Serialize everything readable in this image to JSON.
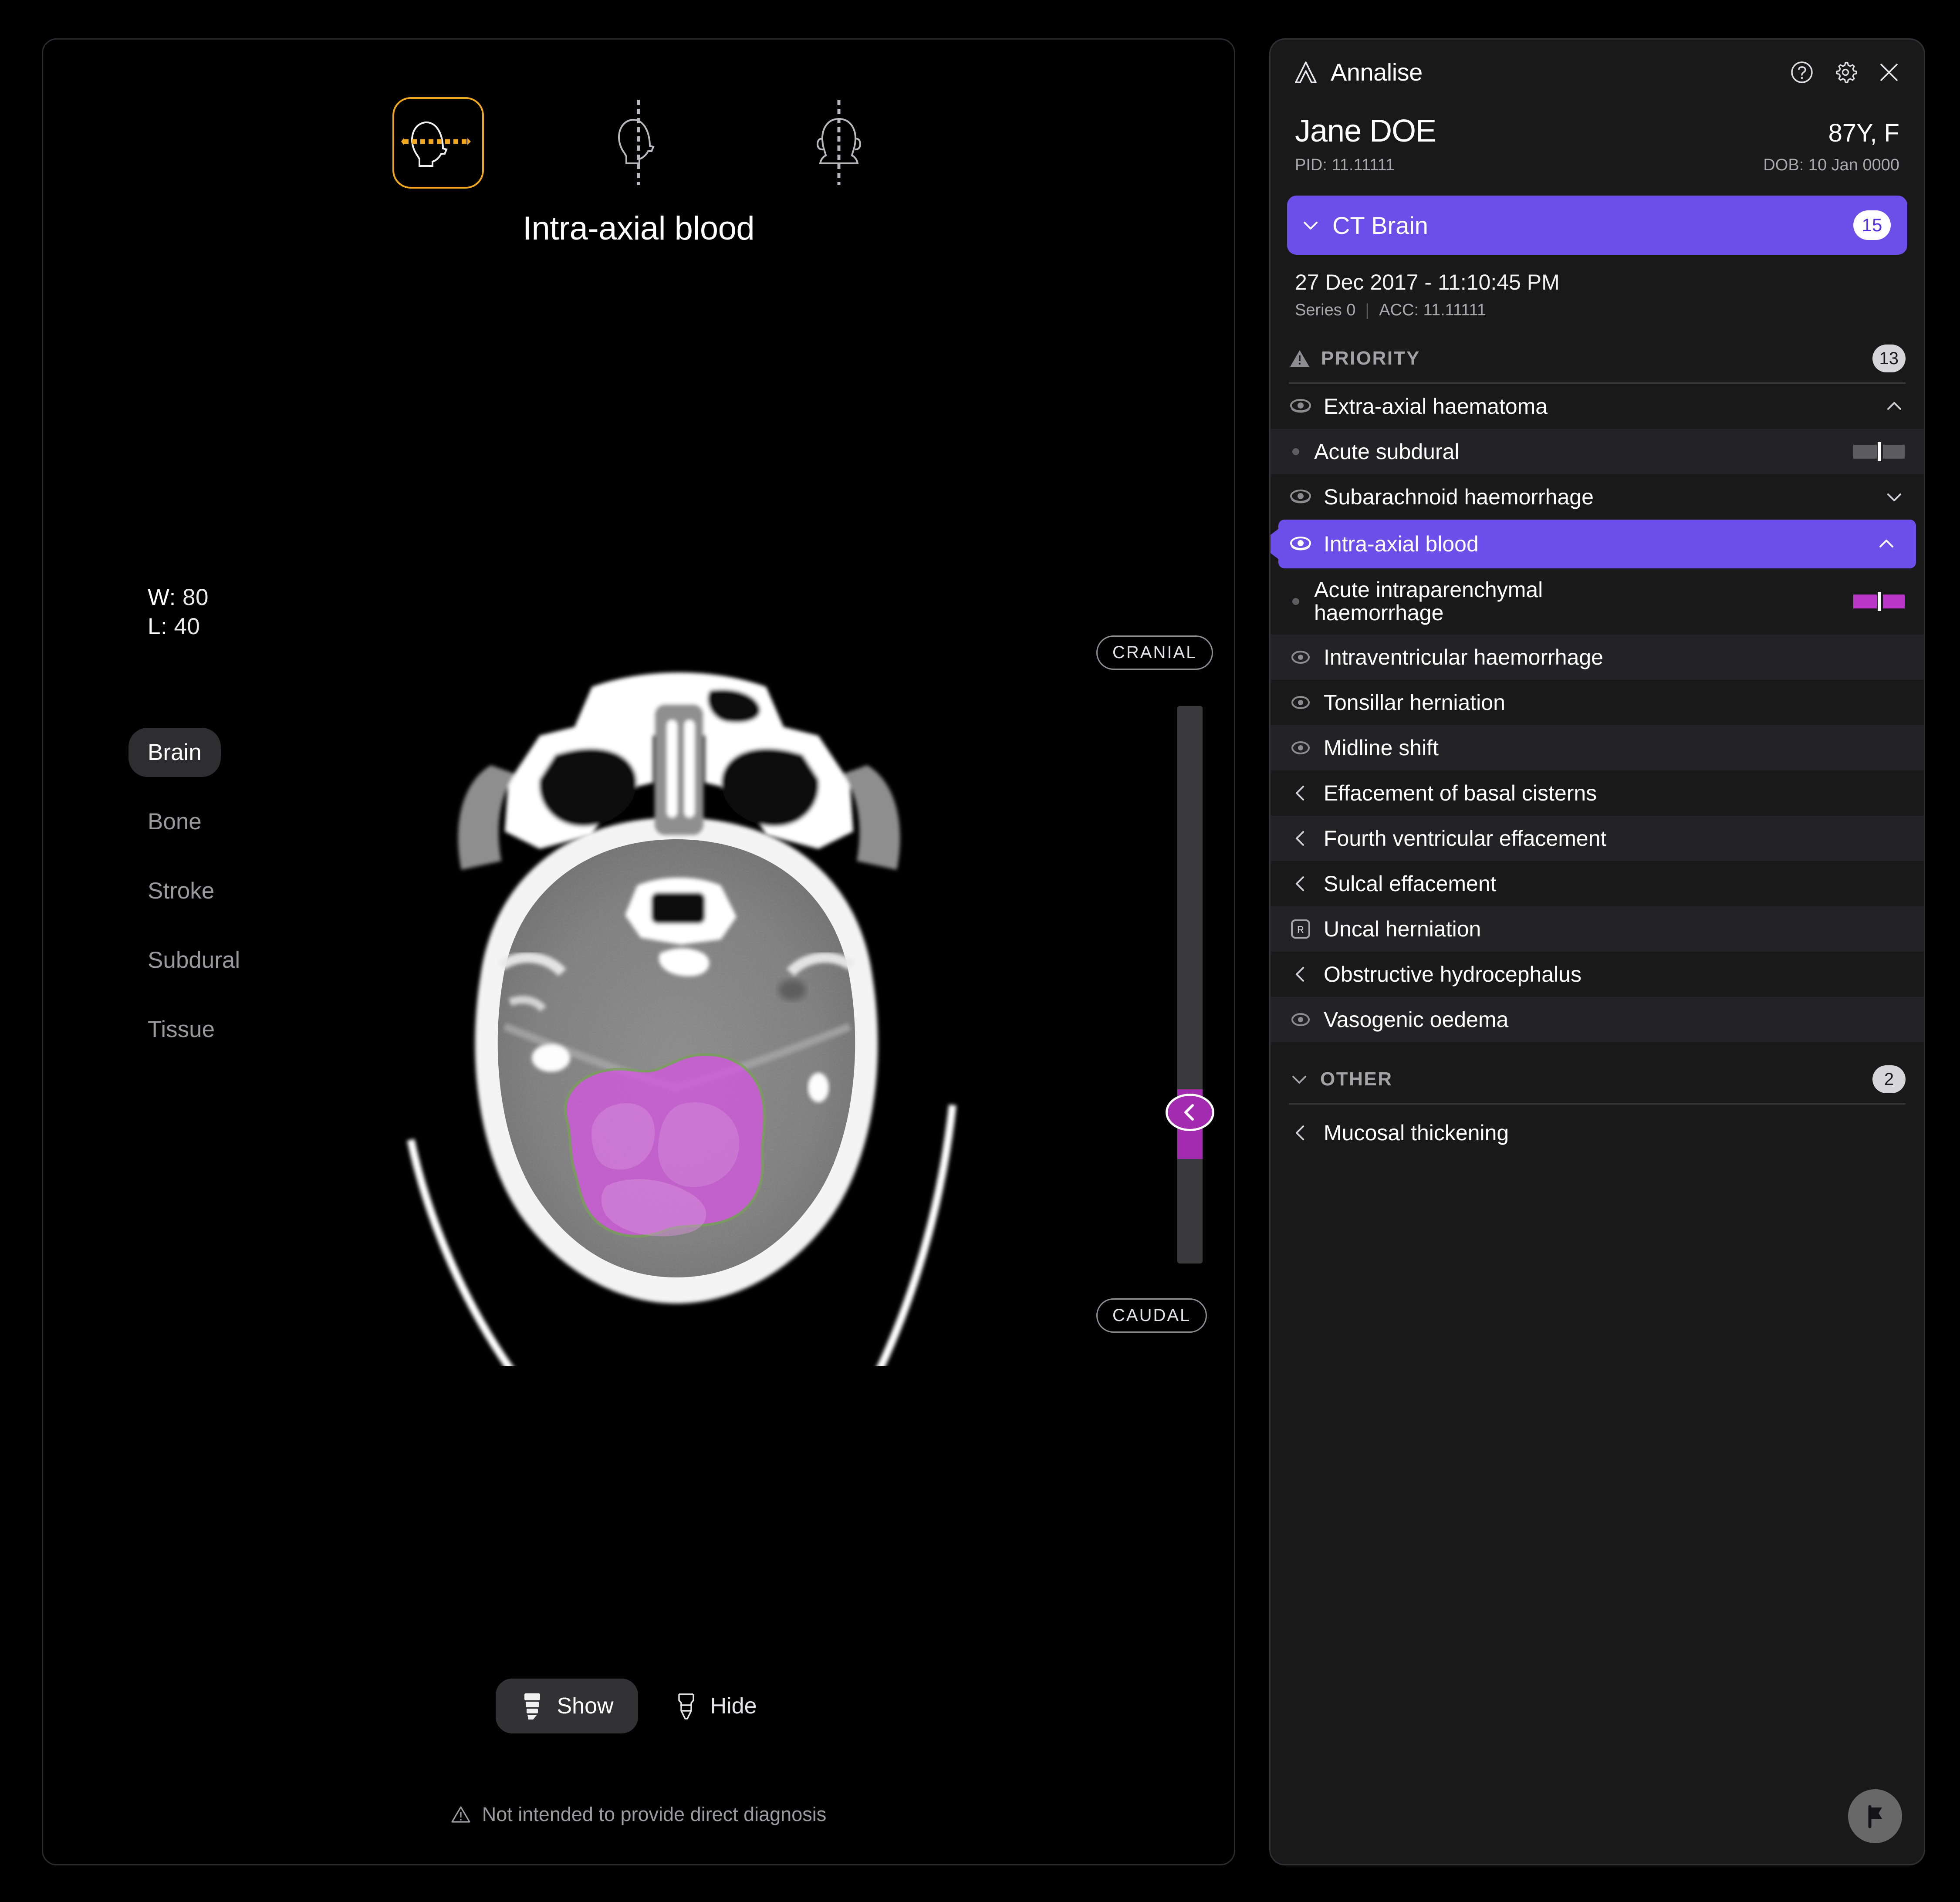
{
  "viewer": {
    "orientations": [
      {
        "name": "axial",
        "label": "Axial",
        "active": true
      },
      {
        "name": "sagittal",
        "label": "Sagittal",
        "active": false
      },
      {
        "name": "coronal",
        "label": "Coronal",
        "active": false
      }
    ],
    "slice_title": "Intra-axial blood",
    "window": {
      "width_label": "W:",
      "width_value": "80",
      "level_label": "L:",
      "level_value": "40"
    },
    "presets": [
      {
        "label": "Brain",
        "active": true
      },
      {
        "label": "Bone",
        "active": false
      },
      {
        "label": "Stroke",
        "active": false
      },
      {
        "label": "Subdural",
        "active": false
      },
      {
        "label": "Tissue",
        "active": false
      }
    ],
    "scroll": {
      "top_label": "CRANIAL",
      "bottom_label": "CAUDAL",
      "handle_icon": "chevron-left-icon"
    },
    "overlay_controls": {
      "show_label": "Show",
      "show_active": true,
      "hide_label": "Hide",
      "hide_active": false
    },
    "disclaimer": "Not intended to provide direct diagnosis",
    "overlay_color": "#D457E0"
  },
  "panel": {
    "brand": "Annalise",
    "header_icons": [
      "help-icon",
      "gear-icon",
      "close-icon"
    ],
    "patient": {
      "name": "Jane DOE",
      "age_sex": "87Y, F",
      "pid": "PID: 11.11111",
      "dob": "DOB: 10 Jan 0000"
    },
    "study": {
      "title": "CT Brain",
      "count": "15",
      "datetime": "27 Dec 2017 - 11:10:45 PM",
      "series": "Series 0",
      "accession": "ACC: 11.11111"
    },
    "sections": [
      {
        "id": "priority",
        "title": "PRIORITY",
        "icon": "warning-triangle-icon",
        "count": "13",
        "collapsed": false,
        "items": [
          {
            "label": "Extra-axial haematoma",
            "icon": "eye-icon",
            "chevron": "chevron-up-icon",
            "type": "parent",
            "alt": false
          },
          {
            "label": "Acute subdural",
            "icon": "dot-icon",
            "type": "child",
            "gauge": "gray",
            "alt": true
          },
          {
            "label": "Subarachnoid haemorrhage",
            "icon": "eye-icon",
            "chevron": "chevron-down-icon",
            "type": "parent",
            "alt": false
          },
          {
            "label": "Intra-axial blood",
            "icon": "eye-icon",
            "chevron": "chevron-up-icon",
            "type": "parent",
            "alt": false,
            "selected": true
          },
          {
            "label": "Acute intraparenchymal haemorrhage",
            "icon": "dot-icon",
            "type": "child",
            "gauge": "magenta",
            "alt": false
          },
          {
            "label": "Intraventricular haemorrhage",
            "icon": "eye-icon",
            "type": "parent",
            "alt": true
          },
          {
            "label": "Tonsillar herniation",
            "icon": "eye-icon",
            "type": "parent",
            "alt": false
          },
          {
            "label": "Midline shift",
            "icon": "eye-icon",
            "type": "parent",
            "alt": true
          },
          {
            "label": "Effacement of basal cisterns",
            "icon": "chevron-left-icon",
            "type": "parent",
            "alt": false
          },
          {
            "label": "Fourth ventricular effacement",
            "icon": "chevron-left-icon",
            "type": "parent",
            "alt": true
          },
          {
            "label": "Sulcal effacement",
            "icon": "chevron-left-icon",
            "type": "parent",
            "alt": false
          },
          {
            "label": "Uncal herniation",
            "icon": "r-box-icon",
            "type": "parent",
            "alt": true
          },
          {
            "label": "Obstructive hydrocephalus",
            "icon": "chevron-left-icon",
            "type": "parent",
            "alt": false
          },
          {
            "label": "Vasogenic oedema",
            "icon": "eye-icon",
            "type": "parent",
            "alt": true
          }
        ]
      },
      {
        "id": "other",
        "title": "OTHER",
        "icon": "chevron-down-icon",
        "count": "2",
        "collapsed": false,
        "items": [
          {
            "label": "Mucosal thickening",
            "icon": "chevron-left-icon",
            "type": "parent",
            "alt": false
          }
        ]
      }
    ],
    "flag_button_icon": "flag-icon"
  },
  "colors": {
    "accent_purple": "#6B4FE8",
    "overlay_magenta": "#D457E0",
    "slider_magenta": "#A32BB0",
    "active_orange": "#F2A81D",
    "panel_bg": "#19191A"
  }
}
